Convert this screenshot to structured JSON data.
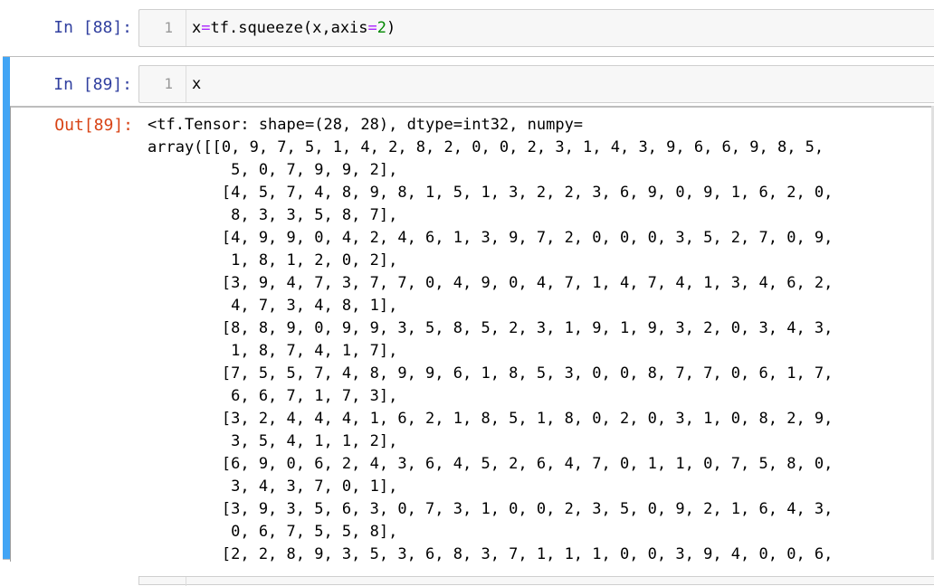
{
  "cells": [
    {
      "prompt": "In  [88]:",
      "line_number": "1",
      "code": {
        "a": "x",
        "b": "=",
        "c": "tf.squeeze",
        "d": "(",
        "e": "x,axis",
        "f": "=",
        "g": "2",
        "h": ")"
      }
    },
    {
      "prompt": "In  [89]:",
      "line_number": "1",
      "code_text": "x",
      "out_prompt": "Out[89]:",
      "output": "<tf.Tensor: shape=(28, 28), dtype=int32, numpy=\narray([[0, 9, 7, 5, 1, 4, 2, 8, 2, 0, 0, 2, 3, 1, 4, 3, 9, 6, 6, 9, 8, 5,\n         5, 0, 7, 9, 9, 2],\n        [4, 5, 7, 4, 8, 9, 8, 1, 5, 1, 3, 2, 2, 3, 6, 9, 0, 9, 1, 6, 2, 0,\n         8, 3, 3, 5, 8, 7],\n        [4, 9, 9, 0, 4, 2, 4, 6, 1, 3, 9, 7, 2, 0, 0, 0, 3, 5, 2, 7, 0, 9,\n         1, 8, 1, 2, 0, 2],\n        [3, 9, 4, 7, 3, 7, 7, 0, 4, 9, 0, 4, 7, 1, 4, 7, 4, 1, 3, 4, 6, 2,\n         4, 7, 3, 4, 8, 1],\n        [8, 8, 9, 0, 9, 9, 3, 5, 8, 5, 2, 3, 1, 9, 1, 9, 3, 2, 0, 3, 4, 3,\n         1, 8, 7, 4, 1, 7],\n        [7, 5, 5, 7, 4, 8, 9, 9, 6, 1, 8, 5, 3, 0, 0, 8, 7, 7, 0, 6, 1, 7,\n         6, 6, 7, 1, 7, 3],\n        [3, 2, 4, 4, 4, 1, 6, 2, 1, 8, 5, 1, 8, 0, 2, 0, 3, 1, 0, 8, 2, 9,\n         3, 5, 4, 1, 1, 2],\n        [6, 9, 0, 6, 2, 4, 3, 6, 4, 5, 2, 6, 4, 7, 0, 1, 1, 0, 7, 5, 8, 0,\n         3, 4, 3, 7, 0, 1],\n        [3, 9, 3, 5, 6, 3, 0, 7, 3, 1, 0, 0, 2, 3, 5, 0, 9, 2, 1, 6, 4, 3,\n         0, 6, 7, 5, 5, 8],\n        [2, 2, 8, 9, 3, 5, 3, 6, 8, 3, 7, 1, 1, 1, 0, 0, 3, 9, 4, 0, 0, 6,"
    }
  ],
  "colors": {
    "in_prompt": "#303f9f",
    "out_prompt": "#d84315",
    "selected_bar": "#42a5f5",
    "operator": "#aa22ff",
    "number": "#008800"
  }
}
